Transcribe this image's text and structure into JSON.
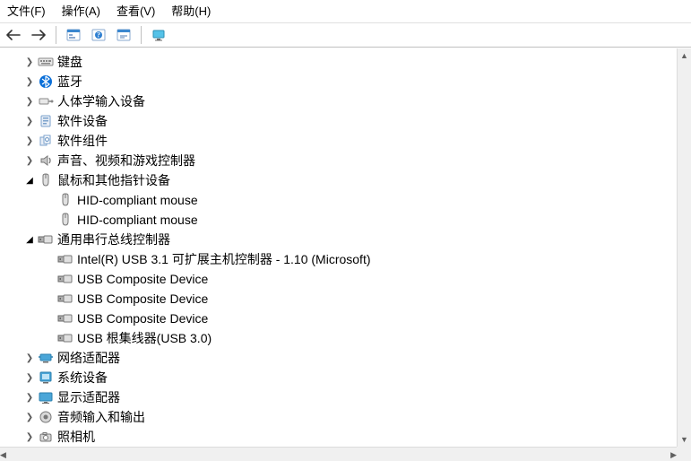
{
  "menu": {
    "file": "文件(F)",
    "action": "操作(A)",
    "view": "查看(V)",
    "help": "帮助(H)"
  },
  "toolbar_icons": {
    "back": "back-arrow-icon",
    "forward": "forward-arrow-icon",
    "properties": "properties-icon",
    "help": "help-icon",
    "show_hidden": "show-hidden-icon",
    "monitor": "monitor-icon"
  },
  "tree": [
    {
      "indent": 1,
      "chev": "closed",
      "icon": "keyboard",
      "label": "键盘"
    },
    {
      "indent": 1,
      "chev": "closed",
      "icon": "bluetooth",
      "label": "蓝牙"
    },
    {
      "indent": 1,
      "chev": "closed",
      "icon": "hid",
      "label": "人体学输入设备"
    },
    {
      "indent": 1,
      "chev": "closed",
      "icon": "software-dev",
      "label": "软件设备"
    },
    {
      "indent": 1,
      "chev": "closed",
      "icon": "software-comp",
      "label": "软件组件"
    },
    {
      "indent": 1,
      "chev": "closed",
      "icon": "sound",
      "label": "声音、视频和游戏控制器"
    },
    {
      "indent": 1,
      "chev": "open",
      "icon": "mouse",
      "label": "鼠标和其他指针设备"
    },
    {
      "indent": 2,
      "chev": "none",
      "icon": "mouse",
      "label": "HID-compliant mouse"
    },
    {
      "indent": 2,
      "chev": "none",
      "icon": "mouse",
      "label": "HID-compliant mouse"
    },
    {
      "indent": 1,
      "chev": "open",
      "icon": "usb",
      "label": "通用串行总线控制器"
    },
    {
      "indent": 2,
      "chev": "none",
      "icon": "usb",
      "label": "Intel(R) USB 3.1 可扩展主机控制器 - 1.10 (Microsoft)"
    },
    {
      "indent": 2,
      "chev": "none",
      "icon": "usb",
      "label": "USB Composite Device"
    },
    {
      "indent": 2,
      "chev": "none",
      "icon": "usb",
      "label": "USB Composite Device"
    },
    {
      "indent": 2,
      "chev": "none",
      "icon": "usb",
      "label": "USB Composite Device"
    },
    {
      "indent": 2,
      "chev": "none",
      "icon": "usb",
      "label": "USB 根集线器(USB 3.0)"
    },
    {
      "indent": 1,
      "chev": "closed",
      "icon": "network",
      "label": "网络适配器"
    },
    {
      "indent": 1,
      "chev": "closed",
      "icon": "system",
      "label": "系统设备"
    },
    {
      "indent": 1,
      "chev": "closed",
      "icon": "display",
      "label": "显示适配器"
    },
    {
      "indent": 1,
      "chev": "closed",
      "icon": "audio-io",
      "label": "音频输入和输出"
    },
    {
      "indent": 1,
      "chev": "closed",
      "icon": "camera",
      "label": "照相机"
    }
  ]
}
